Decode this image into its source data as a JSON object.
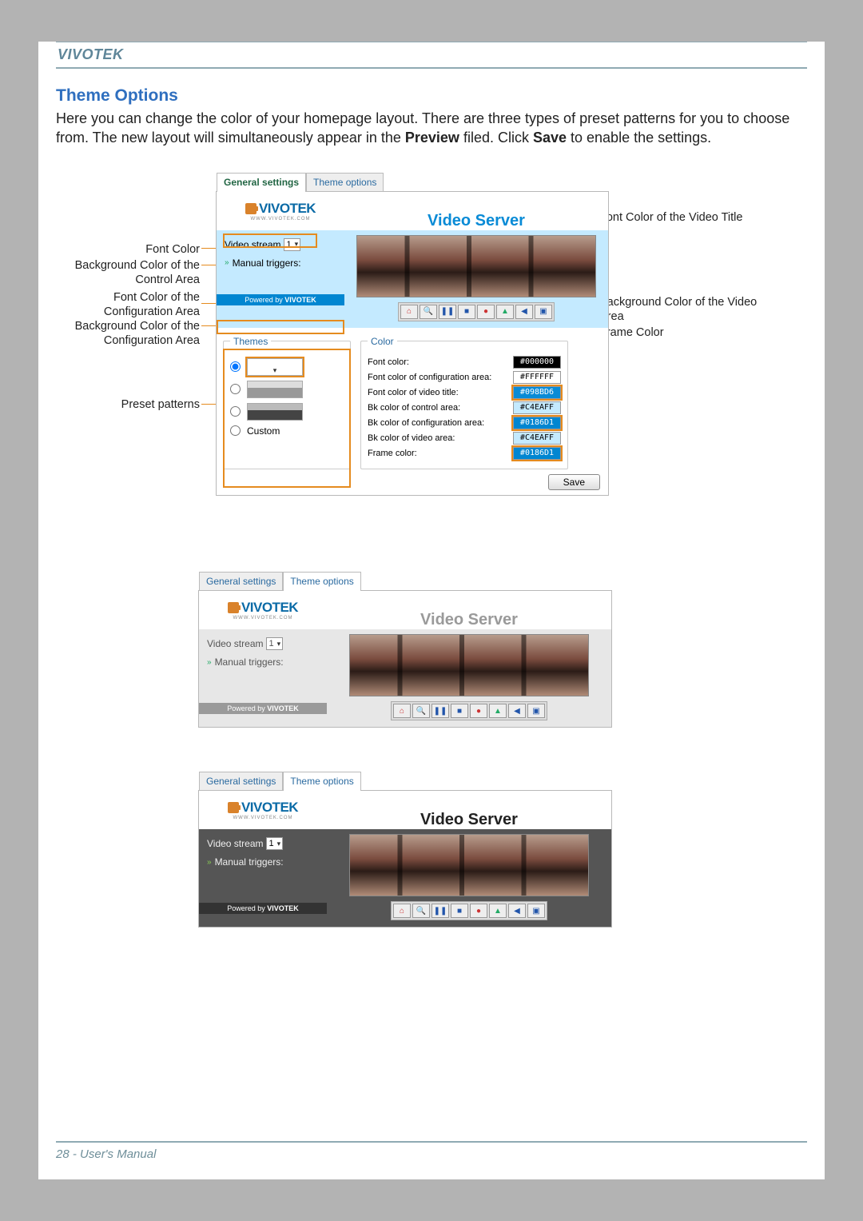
{
  "header": {
    "brand": "VIVOTEK"
  },
  "section": {
    "title": "Theme Options",
    "paragraph_pre": "Here you can change the color of your homepage layout. There are three types of preset patterns for you to choose from. The new layout will simultaneously appear in the ",
    "preview_word": "Preview",
    "paragraph_mid": " filed. Click ",
    "save_word": "Save",
    "paragraph_post": " to enable the settings."
  },
  "callouts": {
    "font_color": "Font Color",
    "bg_control": "Background Color of the Control Area",
    "font_config": "Font Color of the Configuration Area",
    "bg_config": "Background Color of the Configuration Area",
    "preset": "Preset patterns",
    "font_title": "Font Color of the Video Title",
    "bg_video": "Background Color of the Video Area",
    "frame_color": "Frame Color"
  },
  "tabs": {
    "general": "General settings",
    "theme": "Theme options"
  },
  "app": {
    "logo_text": "VIVOTEK",
    "logo_sub": "WWW.VIVOTEK.COM",
    "title": "Video Server",
    "video_stream_label": "Video stream",
    "video_stream_value": "1",
    "manual_triggers": "Manual triggers:",
    "powered_by": "Powered by",
    "icons": [
      "home",
      "zoom",
      "pause",
      "stop",
      "rec",
      "snap",
      "vol",
      "full"
    ]
  },
  "themes_legend": "Themes",
  "theme_custom": "Custom",
  "color_legend": "Color",
  "color_rows": [
    {
      "label": "Font color:",
      "value": "#000000",
      "bg": "#000000",
      "fg": "#ffffff"
    },
    {
      "label": "Font color of configuration area:",
      "value": "#FFFFFF",
      "bg": "#ffffff",
      "fg": "#000000"
    },
    {
      "label": "Font color of video title:",
      "value": "#098BD6",
      "bg": "#098BD6",
      "fg": "#ffffff"
    },
    {
      "label": "Bk color of control area:",
      "value": "#C4EAFF",
      "bg": "#C4EAFF",
      "fg": "#000000"
    },
    {
      "label": "Bk color of configuration area:",
      "value": "#0186D1",
      "bg": "#0186D1",
      "fg": "#ffffff"
    },
    {
      "label": "Bk color of video area:",
      "value": "#C4EAFF",
      "bg": "#C4EAFF",
      "fg": "#000000"
    },
    {
      "label": "Frame color:",
      "value": "#0186D1",
      "bg": "#0186D1",
      "fg": "#ffffff"
    }
  ],
  "save_btn": "Save",
  "footer": "28 - User's Manual"
}
